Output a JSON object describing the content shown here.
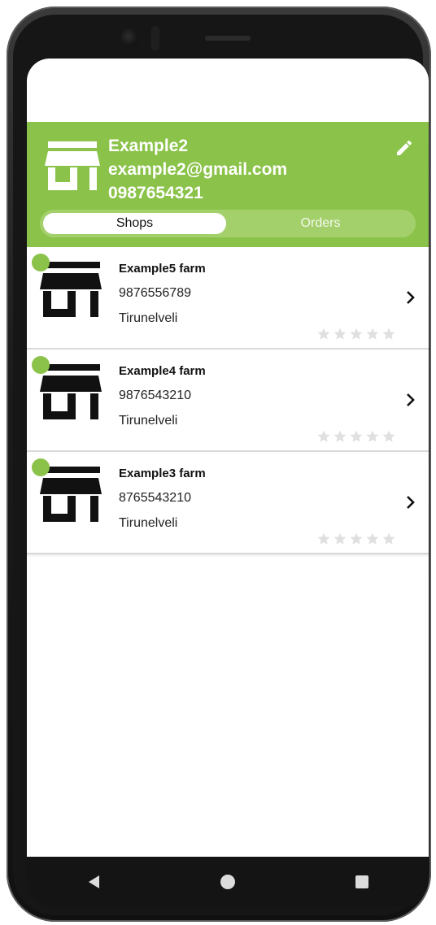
{
  "header": {
    "name": "Example2",
    "email": "example2@gmail.com",
    "phone": "0987654321",
    "brand_color": "#8bc34a"
  },
  "tabs": [
    {
      "label": "Shops",
      "selected": true
    },
    {
      "label": "Orders",
      "selected": false
    }
  ],
  "shops": [
    {
      "name": "Example5 farm",
      "phone": "9876556789",
      "city": "Tirunelveli",
      "rating": 0
    },
    {
      "name": "Example4 farm",
      "phone": "9876543210",
      "city": "Tirunelveli",
      "rating": 0
    },
    {
      "name": "Example3 farm",
      "phone": "8765543210",
      "city": "Tirunelveli",
      "rating": 0
    }
  ],
  "icons": {
    "store": "store-icon",
    "edit": "pencil-icon",
    "chevron": "chevron-right-icon",
    "star": "star-icon",
    "back": "back-triangle-icon",
    "home": "home-circle-icon",
    "recents": "recents-square-icon"
  }
}
